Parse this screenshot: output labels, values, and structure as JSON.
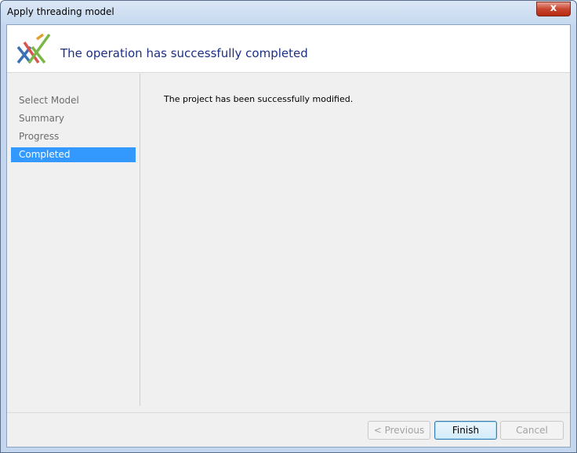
{
  "window": {
    "title": "Apply threading model",
    "close_label": "x"
  },
  "header": {
    "title": "The operation has successfully completed",
    "logo_icon": "wizard-logo-icon"
  },
  "nav": {
    "items": [
      {
        "label": "Select Model",
        "active": false
      },
      {
        "label": "Summary",
        "active": false
      },
      {
        "label": "Progress",
        "active": false
      },
      {
        "label": "Completed",
        "active": true
      }
    ]
  },
  "content": {
    "message": "The project has been successfully modified."
  },
  "footer": {
    "previous_label": "< Previous",
    "finish_label": "Finish",
    "cancel_label": "Cancel"
  },
  "colors": {
    "accent": "#3399ff",
    "title_blue": "#1c2f84"
  }
}
